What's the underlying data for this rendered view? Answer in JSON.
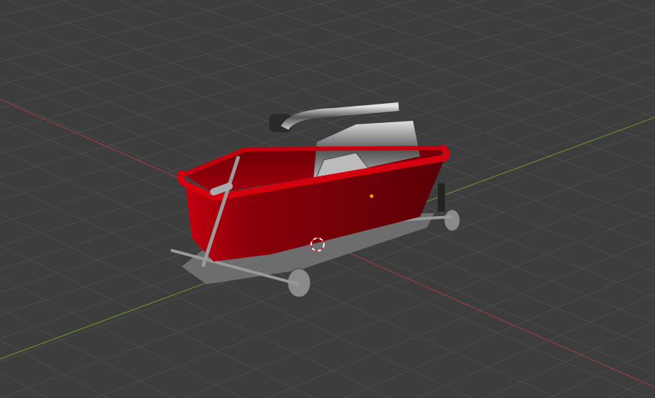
{
  "viewport": {
    "background_color": "#3d3d3d",
    "grid_color": "#4b4b4b",
    "x_axis_color": "#9b3a45",
    "y_axis_color": "#6a8a2c"
  },
  "model": {
    "body_color": "#b0000c",
    "metal_color": "#9a9a9a",
    "origin_color": "#ff9a1a"
  }
}
